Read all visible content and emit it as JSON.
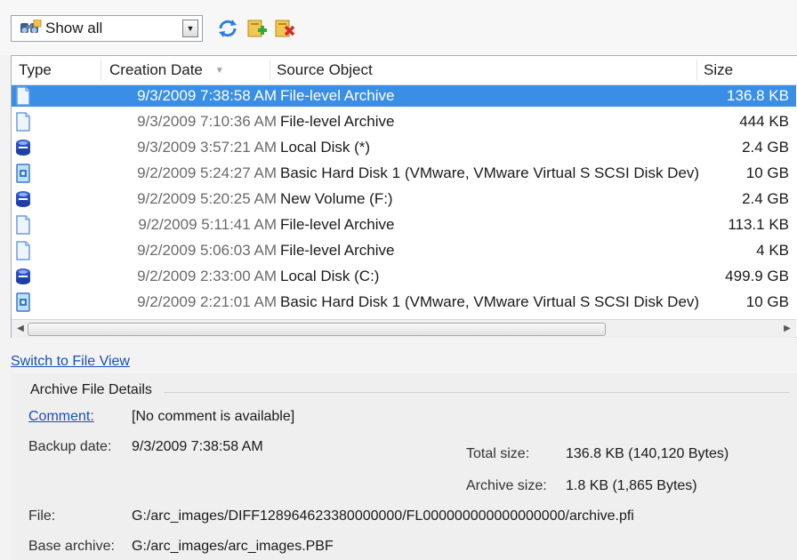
{
  "toolbar": {
    "filter_value": "Show all",
    "icons": [
      "refresh-icon",
      "add-archive-icon",
      "delete-archive-icon"
    ]
  },
  "grid": {
    "columns": [
      "Type",
      "Creation Date",
      "Source Object",
      "Size"
    ],
    "selection_color": "#3a8ee6",
    "rows": [
      {
        "type": "file",
        "date": "9/3/2009 7:38:58 AM",
        "source": "File-level Archive",
        "size": "136.8 KB",
        "selected": true
      },
      {
        "type": "file",
        "date": "9/3/2009 7:10:36 AM",
        "source": "File-level Archive",
        "size": "444 KB"
      },
      {
        "type": "volume",
        "date": "9/3/2009 3:57:21 AM",
        "source": "Local Disk (*)",
        "size": "2.4 GB"
      },
      {
        "type": "disk",
        "date": "9/2/2009 5:24:27 AM",
        "source": "Basic Hard Disk 1 (VMware, VMware Virtual S SCSI Disk Dev)",
        "size": "10 GB"
      },
      {
        "type": "volume",
        "date": "9/2/2009 5:20:25 AM",
        "source": "New Volume (F:)",
        "size": "2.4 GB"
      },
      {
        "type": "file",
        "date": "9/2/2009 5:11:41 AM",
        "source": "File-level Archive",
        "size": "113.1 KB"
      },
      {
        "type": "file",
        "date": "9/2/2009 5:06:03 AM",
        "source": "File-level Archive",
        "size": "4 KB"
      },
      {
        "type": "volume",
        "date": "9/2/2009 2:33:00 AM",
        "source": "Local Disk (C:)",
        "size": "499.9 GB"
      },
      {
        "type": "disk",
        "date": "9/2/2009 2:21:01 AM",
        "source": "Basic Hard Disk 1 (VMware, VMware Virtual S SCSI Disk Dev)",
        "size": "10 GB"
      }
    ]
  },
  "switch_link": "Switch to File View",
  "details": {
    "title": "Archive File Details",
    "comment_label": "Comment:",
    "comment_value": "[No comment is available]",
    "backup_date_label": "Backup date:",
    "backup_date_value": "9/3/2009 7:38:58 AM",
    "total_size_label": "Total size:",
    "total_size_value": "136.8 KB (140,120 Bytes)",
    "archive_size_label": "Archive size:",
    "archive_size_value": "1.8 KB (1,865 Bytes)",
    "file_label": "File:",
    "file_value": "G:/arc_images/DIFF128964623380000000/FL000000000000000000/archive.pfi",
    "base_archive_label": "Base archive:",
    "base_archive_value": "G:/arc_images/arc_images.PBF"
  }
}
